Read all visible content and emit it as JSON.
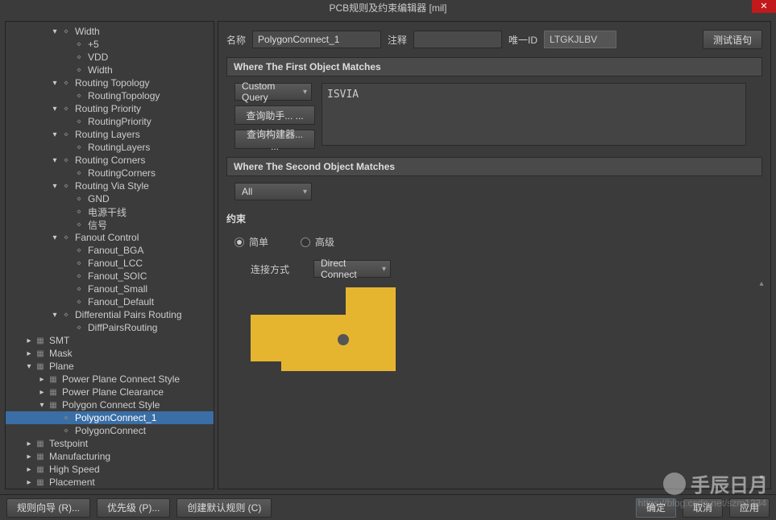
{
  "title": "PCB规则及约束编辑器 [mil]",
  "tree": [
    {
      "depth": 3,
      "arrow": "expanded",
      "icon": "rule",
      "label": "Width"
    },
    {
      "depth": 4,
      "arrow": "none",
      "icon": "rule",
      "label": "+5"
    },
    {
      "depth": 4,
      "arrow": "none",
      "icon": "rule",
      "label": "VDD"
    },
    {
      "depth": 4,
      "arrow": "none",
      "icon": "rule",
      "label": "Width"
    },
    {
      "depth": 3,
      "arrow": "expanded",
      "icon": "rule",
      "label": "Routing Topology"
    },
    {
      "depth": 4,
      "arrow": "none",
      "icon": "rule",
      "label": "RoutingTopology"
    },
    {
      "depth": 3,
      "arrow": "expanded",
      "icon": "rule",
      "label": "Routing Priority"
    },
    {
      "depth": 4,
      "arrow": "none",
      "icon": "rule",
      "label": "RoutingPriority"
    },
    {
      "depth": 3,
      "arrow": "expanded",
      "icon": "rule",
      "label": "Routing Layers"
    },
    {
      "depth": 4,
      "arrow": "none",
      "icon": "rule",
      "label": "RoutingLayers"
    },
    {
      "depth": 3,
      "arrow": "expanded",
      "icon": "rule",
      "label": "Routing Corners"
    },
    {
      "depth": 4,
      "arrow": "none",
      "icon": "rule",
      "label": "RoutingCorners"
    },
    {
      "depth": 3,
      "arrow": "expanded",
      "icon": "rule",
      "label": "Routing Via Style"
    },
    {
      "depth": 4,
      "arrow": "none",
      "icon": "rule",
      "label": "GND"
    },
    {
      "depth": 4,
      "arrow": "none",
      "icon": "rule",
      "label": "电源干线"
    },
    {
      "depth": 4,
      "arrow": "none",
      "icon": "rule",
      "label": "信号"
    },
    {
      "depth": 3,
      "arrow": "expanded",
      "icon": "rule",
      "label": "Fanout Control"
    },
    {
      "depth": 4,
      "arrow": "none",
      "icon": "rule",
      "label": "Fanout_BGA"
    },
    {
      "depth": 4,
      "arrow": "none",
      "icon": "rule",
      "label": "Fanout_LCC"
    },
    {
      "depth": 4,
      "arrow": "none",
      "icon": "rule",
      "label": "Fanout_SOIC"
    },
    {
      "depth": 4,
      "arrow": "none",
      "icon": "rule",
      "label": "Fanout_Small"
    },
    {
      "depth": 4,
      "arrow": "none",
      "icon": "rule",
      "label": "Fanout_Default"
    },
    {
      "depth": 3,
      "arrow": "expanded",
      "icon": "rule",
      "label": "Differential Pairs Routing"
    },
    {
      "depth": 4,
      "arrow": "none",
      "icon": "rule",
      "label": "DiffPairsRouting"
    },
    {
      "depth": 1,
      "arrow": "collapsed",
      "icon": "cat",
      "label": "SMT"
    },
    {
      "depth": 1,
      "arrow": "collapsed",
      "icon": "cat",
      "label": "Mask"
    },
    {
      "depth": 1,
      "arrow": "expanded",
      "icon": "cat",
      "label": "Plane"
    },
    {
      "depth": 2,
      "arrow": "collapsed",
      "icon": "cat",
      "label": "Power Plane Connect Style"
    },
    {
      "depth": 2,
      "arrow": "collapsed",
      "icon": "cat",
      "label": "Power Plane Clearance"
    },
    {
      "depth": 2,
      "arrow": "expanded",
      "icon": "cat",
      "label": "Polygon Connect Style"
    },
    {
      "depth": 3,
      "arrow": "none",
      "icon": "rule",
      "label": "PolygonConnect_1",
      "selected": true
    },
    {
      "depth": 3,
      "arrow": "none",
      "icon": "rule",
      "label": "PolygonConnect"
    },
    {
      "depth": 1,
      "arrow": "collapsed",
      "icon": "cat",
      "label": "Testpoint"
    },
    {
      "depth": 1,
      "arrow": "collapsed",
      "icon": "cat",
      "label": "Manufacturing"
    },
    {
      "depth": 1,
      "arrow": "collapsed",
      "icon": "cat",
      "label": "High Speed"
    },
    {
      "depth": 1,
      "arrow": "collapsed",
      "icon": "cat",
      "label": "Placement"
    }
  ],
  "fields": {
    "name_label": "名称",
    "name_value": "PolygonConnect_1",
    "comment_label": "注释",
    "comment_value": "",
    "uid_label": "唯一ID",
    "uid_value": "LTGKJLBV",
    "test_btn": "测试语句"
  },
  "section1": {
    "header": "Where The First Object Matches",
    "scope": "Custom Query",
    "query": "ISVIA",
    "helper_btn": "查询助手... ...",
    "builder_btn": "查询构建器... ..."
  },
  "section2": {
    "header": "Where The Second Object Matches",
    "scope": "All"
  },
  "constraints": {
    "header": "约束",
    "radio_simple": "简单",
    "radio_adv": "高级",
    "conn_label": "连接方式",
    "conn_value": "Direct Connect"
  },
  "footer": {
    "wizard": "规则向导 (R)...",
    "priority": "优先级 (P)...",
    "defaults": "创建默认规则 (C)",
    "ok": "确定",
    "cancel": "取消",
    "apply": "应用"
  },
  "watermark": {
    "text": "手辰日月",
    "url": "https://blog.csdn.net/szm1234"
  }
}
